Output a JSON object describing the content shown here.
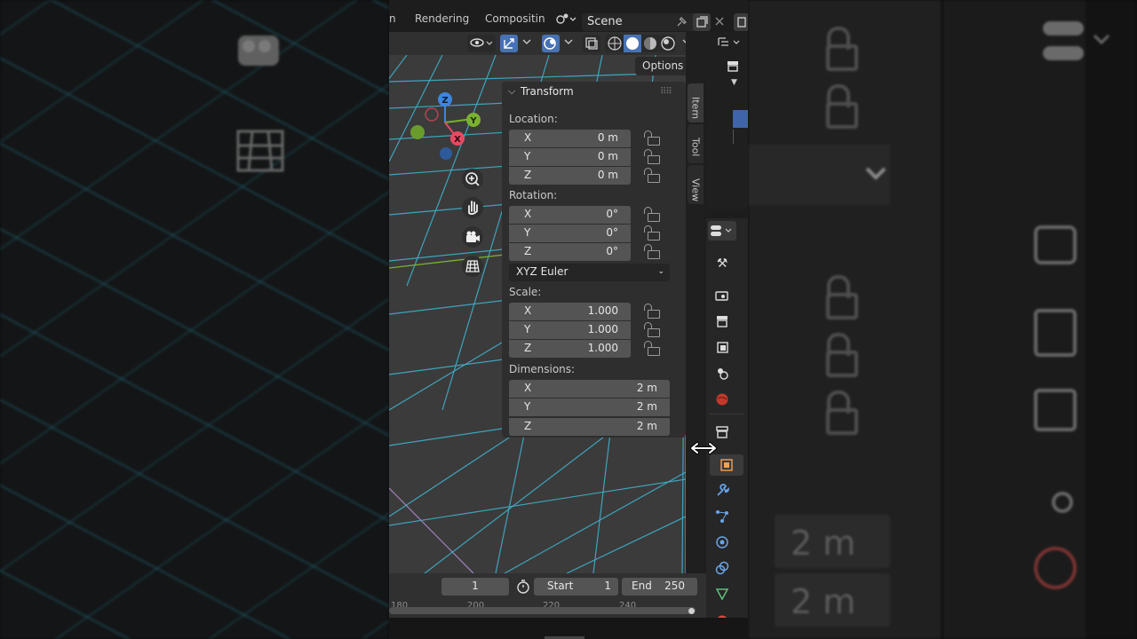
{
  "topbar": {
    "tabs": [
      "n",
      "Rendering",
      "Compositin"
    ],
    "scene": "Scene"
  },
  "viewport": {
    "options_label": "Options",
    "gizmo": {
      "z": "Z",
      "y": "Y",
      "x": "X"
    }
  },
  "transform": {
    "title": "Transform",
    "location_label": "Location:",
    "location": [
      {
        "axis": "X",
        "value": "0 m"
      },
      {
        "axis": "Y",
        "value": "0 m"
      },
      {
        "axis": "Z",
        "value": "0 m"
      }
    ],
    "rotation_label": "Rotation:",
    "rotation": [
      {
        "axis": "X",
        "value": "0°"
      },
      {
        "axis": "Y",
        "value": "0°"
      },
      {
        "axis": "Z",
        "value": "0°"
      }
    ],
    "rotation_mode": "XYZ Euler",
    "scale_label": "Scale:",
    "scale": [
      {
        "axis": "X",
        "value": "1.000"
      },
      {
        "axis": "Y",
        "value": "1.000"
      },
      {
        "axis": "Z",
        "value": "1.000"
      }
    ],
    "dimensions_label": "Dimensions:",
    "dimensions": [
      {
        "axis": "X",
        "value": "2 m"
      },
      {
        "axis": "Y",
        "value": "2 m"
      },
      {
        "axis": "Z",
        "value": "2 m"
      }
    ]
  },
  "sidebar_tabs": [
    "Item",
    "Tool",
    "View"
  ],
  "timeline": {
    "current_frame": "1",
    "start_label": "Start",
    "start_value": "1",
    "end_label": "End",
    "end_value": "250",
    "ticks": [
      "180",
      "200",
      "220",
      "240"
    ]
  },
  "background": {
    "dims": [
      "2 m",
      "2 m"
    ]
  },
  "colors": {
    "grid": "#3fb6d3",
    "axis_x": "#e84a62",
    "axis_y": "#7ab230",
    "axis_z": "#3d86e0",
    "active_tab": "#3a3a3a",
    "highlight": "#3f64a8"
  }
}
